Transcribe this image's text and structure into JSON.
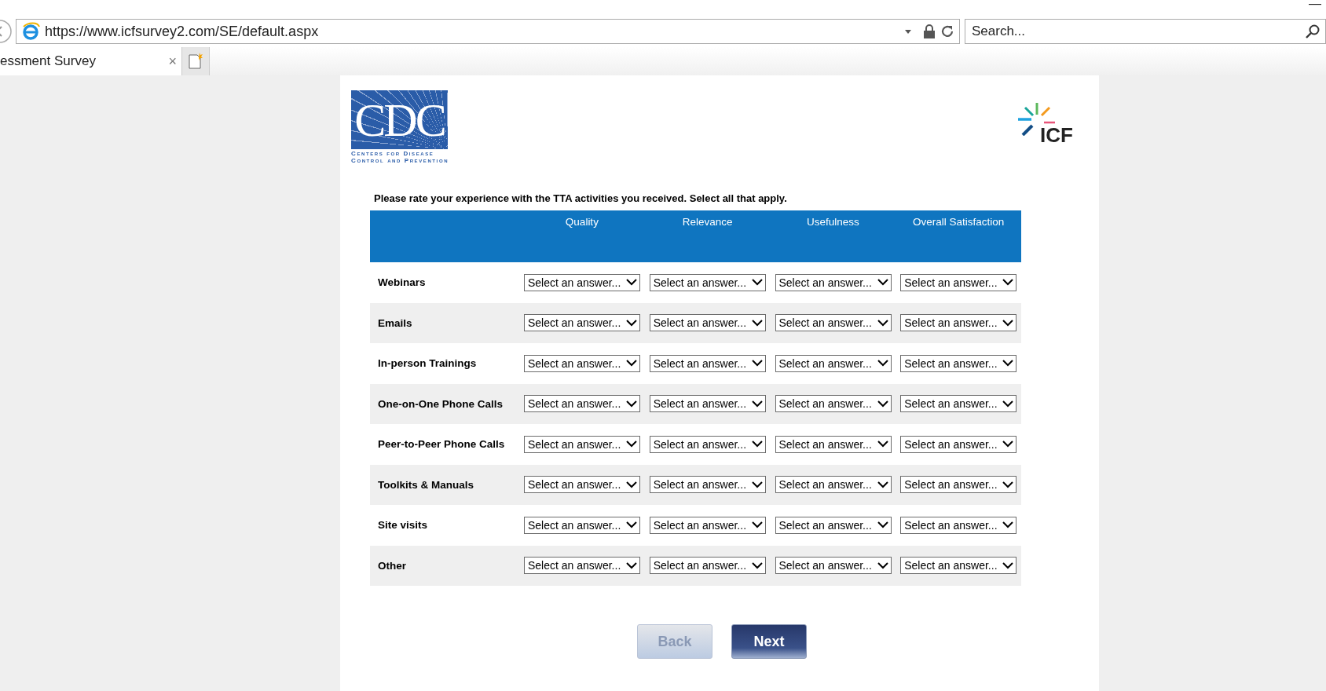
{
  "browser": {
    "address": "https://www.icfsurvey2.com/SE/default.aspx",
    "search": {
      "placeholder": "Search..."
    },
    "tab": {
      "title": "essment Survey",
      "close": "×"
    },
    "minimize": "—"
  },
  "logos": {
    "cdc": {
      "mark": "CDC",
      "caption": "Centers for Disease Control and Prevention"
    },
    "icf": {
      "mark": "ICF"
    }
  },
  "instruction": "Please rate your experience with the TTA activities you received. Select all that apply.",
  "table": {
    "columns": [
      "Quality",
      "Relevance",
      "Usefulness",
      "Overall Satisfaction"
    ],
    "rows": [
      {
        "label": "Webinars",
        "answers": [
          "Select an answer...",
          "Select an answer...",
          "Select an answer...",
          "Select an answer..."
        ]
      },
      {
        "label": "Emails",
        "answers": [
          "Select an answer...",
          "Select an answer...",
          "Select an answer...",
          "Select an answer..."
        ]
      },
      {
        "label": "In-person Trainings",
        "answers": [
          "Select an answer...",
          "Select an answer...",
          "Select an answer...",
          "Select an answer..."
        ]
      },
      {
        "label": "One-on-One Phone Calls",
        "answers": [
          "Select an answer...",
          "Select an answer...",
          "Select an answer...",
          "Select an answer..."
        ]
      },
      {
        "label": "Peer-to-Peer Phone Calls",
        "answers": [
          "Select an answer...",
          "Select an answer...",
          "Select an answer...",
          "Select an answer..."
        ]
      },
      {
        "label": "Toolkits & Manuals",
        "answers": [
          "Select an answer...",
          "Select an answer...",
          "Select an answer...",
          "Select an answer..."
        ]
      },
      {
        "label": "Site visits",
        "answers": [
          "Select an answer...",
          "Select an answer...",
          "Select an answer...",
          "Select an answer..."
        ]
      },
      {
        "label": "Other",
        "answers": [
          "Select an answer...",
          "Select an answer...",
          "Select an answer...",
          "Select an answer..."
        ]
      }
    ]
  },
  "buttons": [
    {
      "label": "Back",
      "disabled": true
    },
    {
      "label": "Next",
      "disabled": false
    }
  ]
}
